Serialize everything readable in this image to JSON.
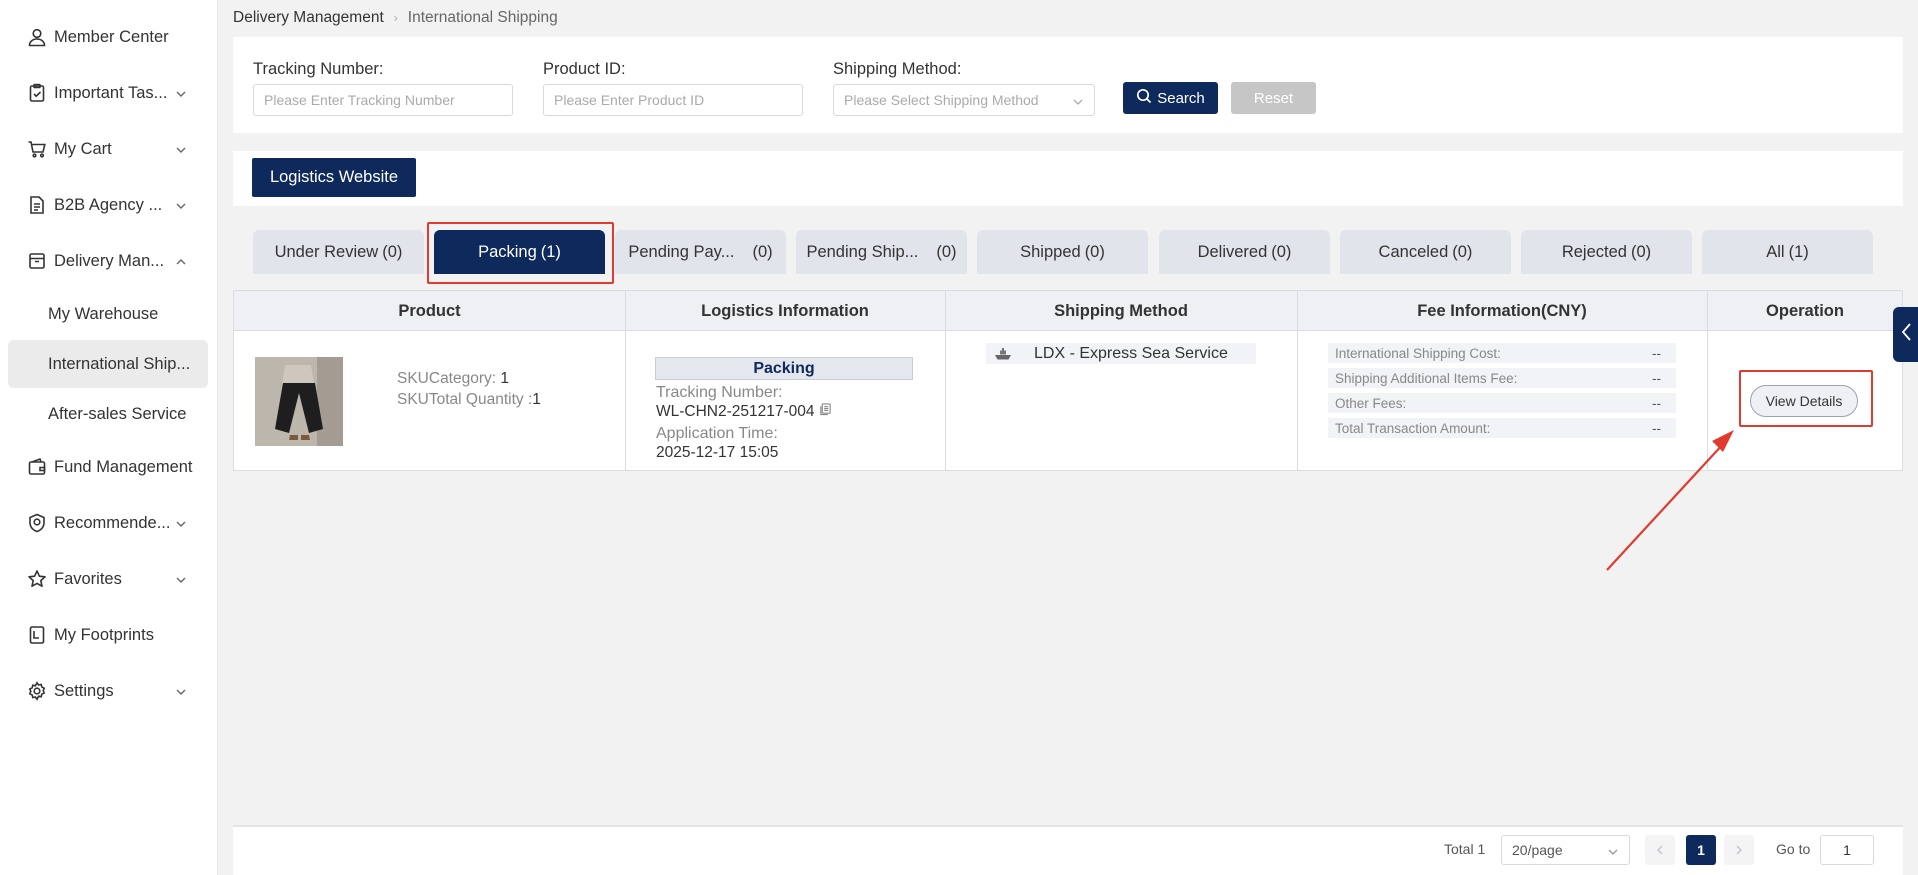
{
  "sidebar": {
    "items": [
      {
        "label": "Member Center",
        "icon": "user-icon"
      },
      {
        "label": "Important Tas...",
        "icon": "clipboard-icon"
      },
      {
        "label": "My Cart",
        "icon": "cart-icon"
      },
      {
        "label": "B2B Agency ...",
        "icon": "document-icon"
      },
      {
        "label": "Delivery Man...",
        "icon": "box-icon"
      },
      {
        "label": "Fund Management",
        "icon": "wallet-icon"
      },
      {
        "label": "Recommende...",
        "icon": "badge-icon"
      },
      {
        "label": "Favorites",
        "icon": "star-icon"
      },
      {
        "label": "My Footprints",
        "icon": "footprint-icon"
      },
      {
        "label": "Settings",
        "icon": "gear-icon"
      }
    ],
    "sub_items": [
      "My Warehouse",
      "International Ship...",
      "After-sales Service"
    ]
  },
  "breadcrumb": {
    "parent": "Delivery Management",
    "current": "International Shipping"
  },
  "search": {
    "tracking_label": "Tracking Number:",
    "tracking_placeholder": "Please Enter Tracking Number",
    "product_label": "Product ID:",
    "product_placeholder": "Please Enter Product ID",
    "shipping_label": "Shipping Method:",
    "shipping_placeholder": "Please Select Shipping Method",
    "search_button": "Search",
    "reset_button": "Reset"
  },
  "logistics_button": "Logistics Website",
  "tabs": [
    {
      "name": "Under Review",
      "count": "(0)"
    },
    {
      "name": "Packing",
      "count": "(1)"
    },
    {
      "name": "Pending Pay...",
      "count": "(0)"
    },
    {
      "name": "Pending Ship...",
      "count": "(0)"
    },
    {
      "name": "Shipped",
      "count": "(0)"
    },
    {
      "name": "Delivered",
      "count": "(0)"
    },
    {
      "name": "Canceled",
      "count": "(0)"
    },
    {
      "name": "Rejected",
      "count": "(0)"
    },
    {
      "name": "All",
      "count": "(1)"
    }
  ],
  "table": {
    "headers": [
      "Product",
      "Logistics Information",
      "Shipping Method",
      "Fee Information(CNY)",
      "Operation"
    ],
    "row": {
      "sku_category_label": "SKUCategory:",
      "sku_category_value": "1",
      "sku_total_label": "SKUTotal Quantity :",
      "sku_total_value": "1",
      "status": "Packing",
      "tracking_label": "Tracking Number:",
      "tracking_value": "WL-CHN2-251217-004",
      "application_label": "Application Time:",
      "application_value": "2025-12-17 15:05",
      "shipping_method": "LDX - Express Sea Service",
      "fees": [
        {
          "label": "International Shipping Cost:",
          "value": "--"
        },
        {
          "label": "Shipping Additional Items Fee:",
          "value": "--"
        },
        {
          "label": "Other Fees:",
          "value": "--"
        },
        {
          "label": "Total Transaction Amount:",
          "value": "--"
        }
      ],
      "operation": "View Details"
    }
  },
  "pagination": {
    "total": "Total 1",
    "page_size": "20/page",
    "current_page": "1",
    "goto_label": "Go to",
    "goto_value": "1"
  },
  "colors": {
    "primary": "#0e2a5c",
    "annotation": "#e03b2e"
  }
}
